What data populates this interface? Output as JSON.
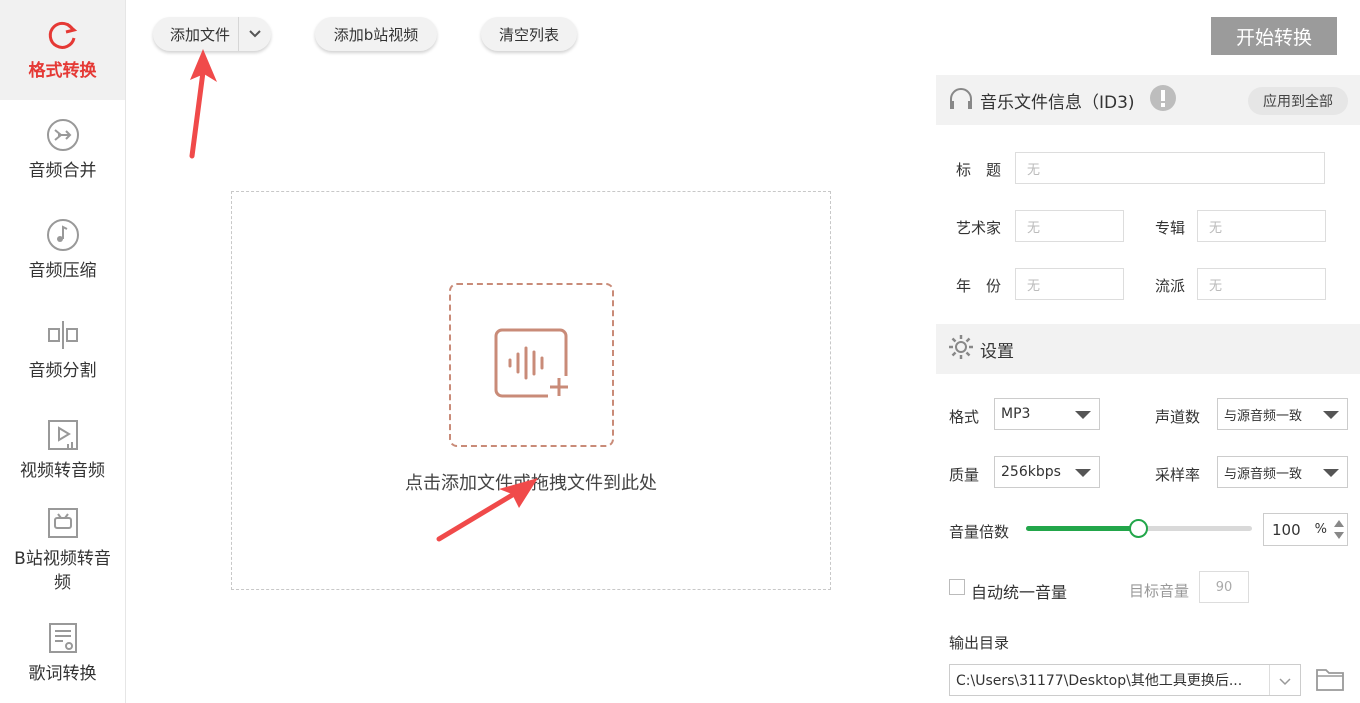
{
  "sidebar": {
    "items": [
      {
        "label": "格式转换",
        "icon": "refresh-icon",
        "active": true
      },
      {
        "label": "音频合并",
        "icon": "merge-icon"
      },
      {
        "label": "音频压缩",
        "icon": "music-note-icon"
      },
      {
        "label": "音频分割",
        "icon": "split-icon"
      },
      {
        "label": "视频转音频",
        "icon": "video-icon"
      },
      {
        "label": "B站视频转音频",
        "icon": "bilibili-tv-icon"
      },
      {
        "label": "歌词转换",
        "icon": "lyrics-file-icon"
      }
    ]
  },
  "toolbar": {
    "add_file": "添加文件",
    "add_bilibili": "添加b站视频",
    "clear_list": "清空列表",
    "start": "开始转换"
  },
  "dropzone": {
    "hint": "点击添加文件或拖拽文件到此处",
    "icon": "audio-add-icon"
  },
  "id3": {
    "header": "音乐文件信息（ID3)",
    "apply_all": "应用到全部",
    "title_label": "标　题",
    "artist_label": "艺术家",
    "album_label": "专辑",
    "year_label": "年　份",
    "genre_label": "流派",
    "placeholder": "无"
  },
  "settings": {
    "header": "设置",
    "format_label": "格式",
    "format_value": "MP3",
    "channels_label": "声道数",
    "channels_value": "与源音频一致",
    "quality_label": "质量",
    "quality_value": "256kbps",
    "samplerate_label": "采样率",
    "samplerate_value": "与源音频一致",
    "volume_label": "音量倍数",
    "volume_value": "100",
    "volume_unit": "%",
    "volume_fraction": 0.5,
    "auto_volume_label": "自动统一音量",
    "auto_volume_checked": false,
    "target_volume_label": "目标音量",
    "target_volume_value": "90",
    "output_label": "输出目录",
    "output_path": "C:\\Users\\31177\\Desktop\\其他工具更换后..."
  },
  "colors": {
    "accent_red": "#e53935",
    "slider_green": "#22a64a",
    "start_button": "#9b9b9b",
    "annotation_arrow": "#f04a4a"
  }
}
